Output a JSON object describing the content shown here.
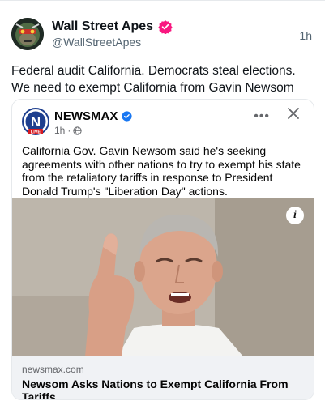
{
  "post": {
    "display_name": "Wall Street Apes",
    "handle": "@WallStreetApes",
    "time": "1h",
    "text": "Federal audit California. Democrats steal elections. We need to exempt California from Gavin Newsom"
  },
  "embed": {
    "source_name": "NEWSMAX",
    "logo_letter": "N",
    "logo_badge": "LIVE",
    "time": "1h",
    "more_label": "•••",
    "text": "California Gov. Gavin Newsom said he's seeking agreements with other nations to try to exempt his state from the retaliatory tariffs in response to President Donald Trump's \"Liberation Day\" actions.",
    "info_label": "i",
    "link_domain": "newsmax.com",
    "link_title": "Newsom Asks Nations to Exempt California From Tariffs"
  },
  "colors": {
    "x_verified": "#f91880",
    "fb_verified": "#1877f2",
    "newsmax_blue": "#1e3f8f",
    "newsmax_red": "#d71920"
  },
  "icons": [
    "verified-badge-icon",
    "globe-icon",
    "more-options-icon",
    "close-icon",
    "info-icon"
  ]
}
